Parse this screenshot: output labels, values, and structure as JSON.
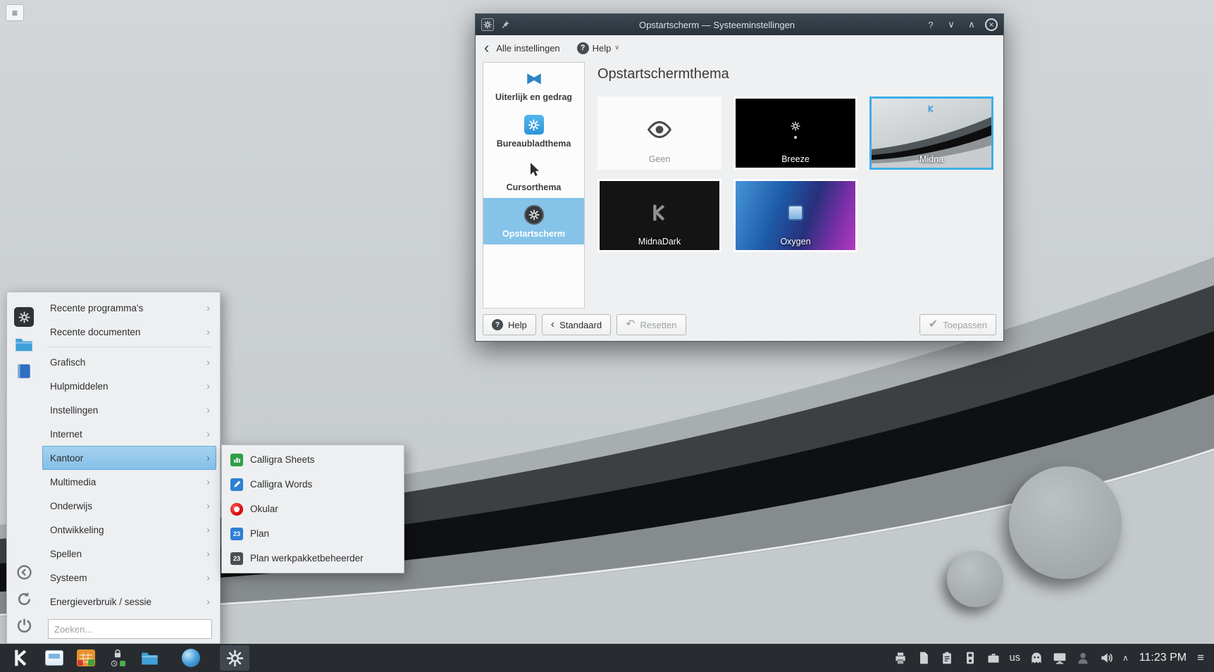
{
  "icons": {
    "hamburger": "≡",
    "back_chevron": "‹",
    "submenu_chevron": "›",
    "chevron_down": "∨",
    "chevron_up": "∧",
    "close": "×",
    "question": "?",
    "check": "✔",
    "undo": "↶"
  },
  "settings_window": {
    "title": "Opstartscherm — Systeeminstellingen",
    "toolbar": {
      "back": "Alle instellingen",
      "help": "Help"
    },
    "sidebar": [
      {
        "label": "Uiterlijk en gedrag",
        "selected": false
      },
      {
        "label": "Bureaubladthema",
        "selected": false
      },
      {
        "label": "Cursorthema",
        "selected": false
      },
      {
        "label": "Opstartscherm",
        "selected": true
      }
    ],
    "page_title": "Opstartschermthema",
    "themes": [
      {
        "name": "Geen",
        "selected": false
      },
      {
        "name": "Breeze",
        "selected": false
      },
      {
        "name": "Midna",
        "selected": true
      },
      {
        "name": "MidnaDark",
        "selected": false
      },
      {
        "name": "Oxygen",
        "selected": false
      }
    ],
    "footer": {
      "help": "Help",
      "standard": "Standaard",
      "reset": "Resetten",
      "apply": "Toepassen"
    }
  },
  "launcher": {
    "categories": [
      "Recente programma's",
      "Recente documenten",
      "Grafisch",
      "Hulpmiddelen",
      "Instellingen",
      "Internet",
      "Kantoor",
      "Multimedia",
      "Onderwijs",
      "Ontwikkeling",
      "Spellen",
      "Systeem",
      "Energieverbruik / sessie"
    ],
    "selected_category": "Kantoor",
    "search_placeholder": "Zoeken...",
    "submenu": [
      {
        "label": "Calligra Sheets"
      },
      {
        "label": "Calligra Words"
      },
      {
        "label": "Okular"
      },
      {
        "label": "Plan",
        "icon_text": "23"
      },
      {
        "label": "Plan werkpakketbeheerder",
        "icon_text": "23"
      }
    ]
  },
  "taskbar": {
    "keyboard_layout": "us",
    "clock": "11:23 PM"
  }
}
